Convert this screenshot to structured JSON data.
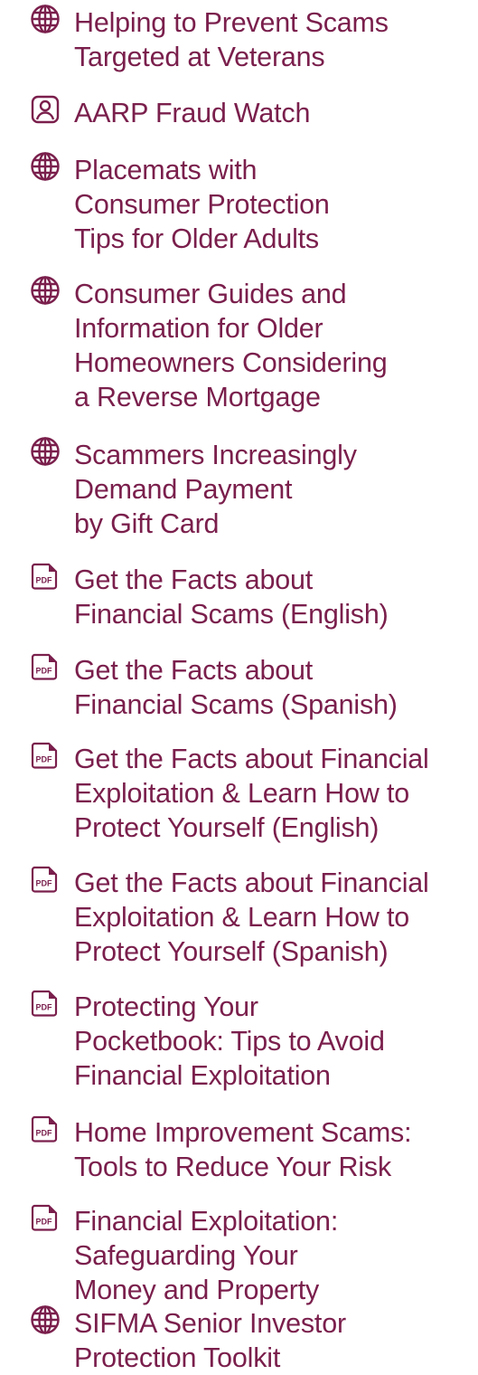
{
  "colors": {
    "accent": "#7a1f4c"
  },
  "resources": [
    {
      "icon": "globe-icon",
      "label": "Helping to Prevent Scams\nTargeted at Veterans"
    },
    {
      "icon": "person-icon",
      "label": "AARP Fraud Watch"
    },
    {
      "icon": "globe-icon",
      "label": "Placemats with\nConsumer Protection\nTips for Older Adults"
    },
    {
      "icon": "globe-icon",
      "label": "Consumer Guides and\nInformation for Older\nHomeowners Considering\na Reverse Mortgage"
    },
    {
      "icon": "globe-icon",
      "label": "Scammers Increasingly\nDemand Payment\nby Gift Card"
    },
    {
      "icon": "pdf-icon",
      "label": "Get the Facts about\nFinancial Scams (English)"
    },
    {
      "icon": "pdf-icon",
      "label": "Get the Facts about\nFinancial Scams (Spanish)"
    },
    {
      "icon": "pdf-icon",
      "label": "Get the Facts about Financial\nExploitation & Learn How to\nProtect Yourself (English)"
    },
    {
      "icon": "pdf-icon",
      "label": "Get the Facts about Financial\nExploitation & Learn How to\nProtect Yourself (Spanish)"
    },
    {
      "icon": "pdf-icon",
      "label": "Protecting Your\nPocketbook:  Tips to Avoid\nFinancial Exploitation"
    },
    {
      "icon": "pdf-icon",
      "label": "Home Improvement Scams:\nTools to Reduce Your Risk"
    },
    {
      "icon": "pdf-icon",
      "label": "Financial Exploitation:\nSafeguarding Your\nMoney and Property"
    },
    {
      "icon": "globe-icon",
      "label": "SIFMA Senior Investor\nProtection Toolkit"
    }
  ],
  "pdf_icon_text": "PDF"
}
